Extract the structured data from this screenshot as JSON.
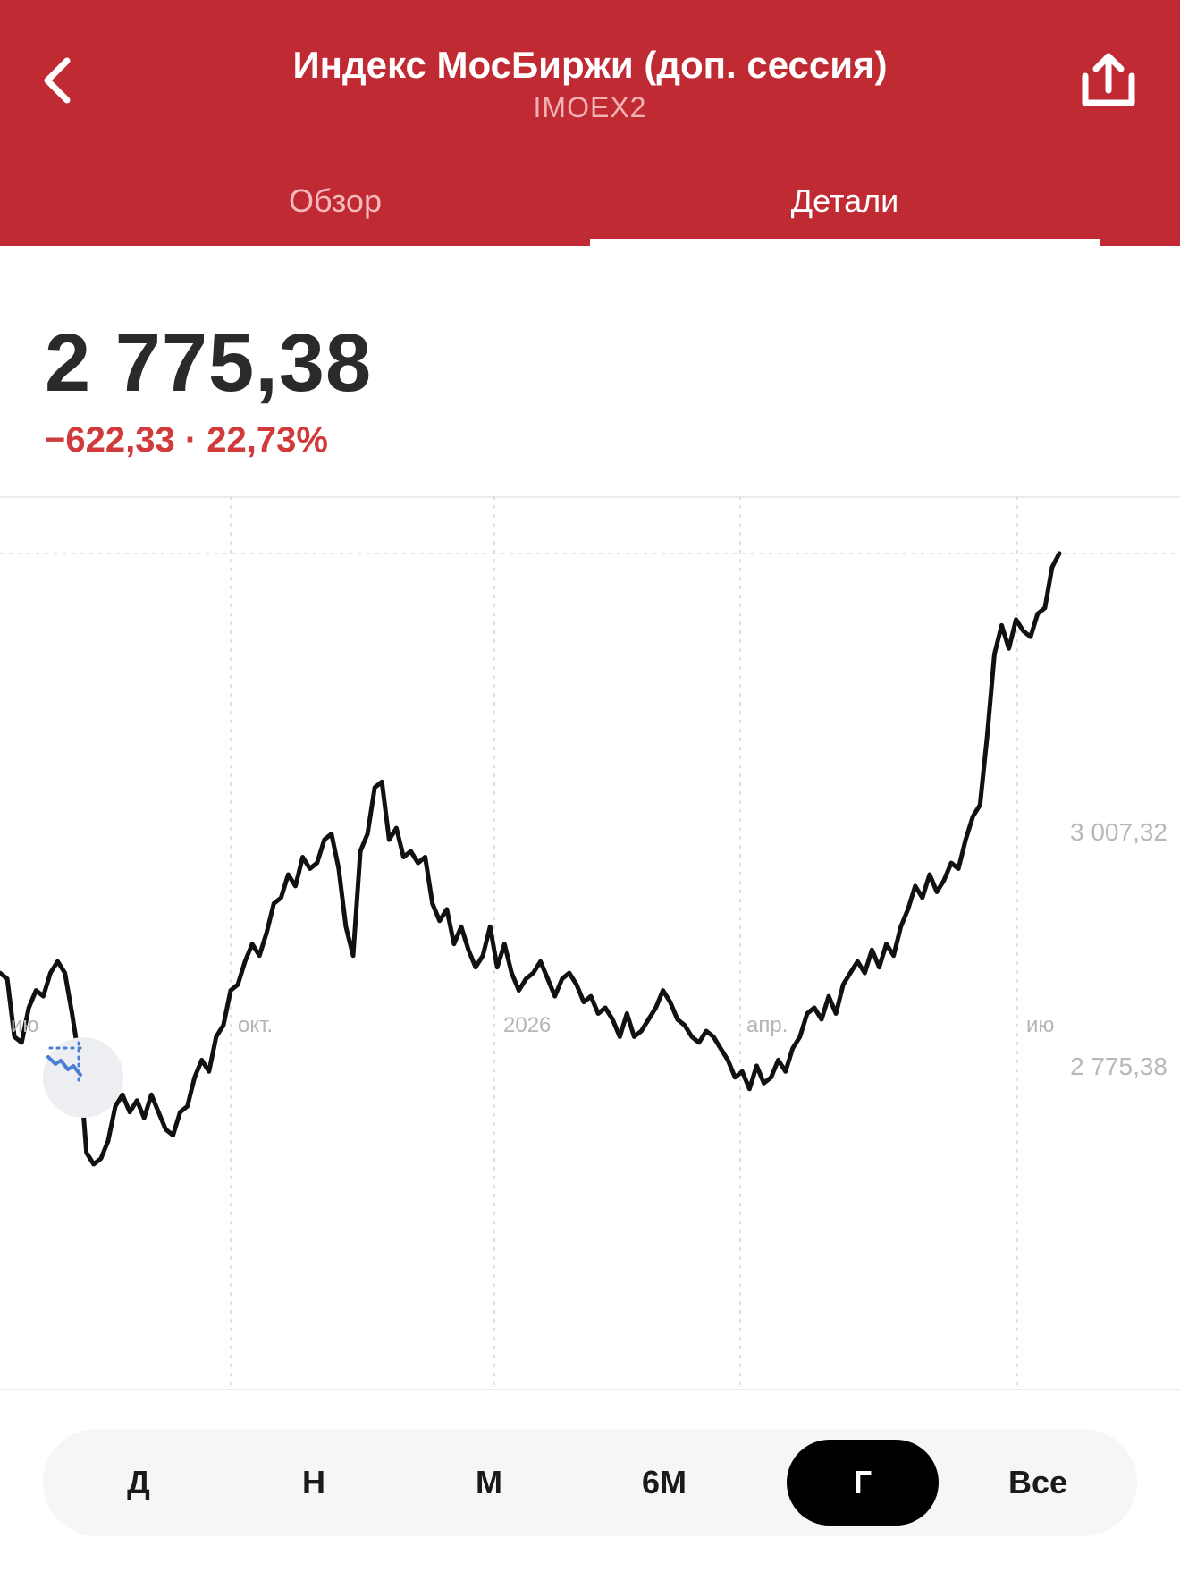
{
  "header": {
    "title": "Индекс МосБиржи (доп. сессия)",
    "ticker": "IMOEX2",
    "back_icon": "back-arrow-icon",
    "share_icon": "share-icon",
    "background_color": "#c02a33"
  },
  "tabs": [
    {
      "label": "Обзор",
      "active": false
    },
    {
      "label": "Детали",
      "active": true
    }
  ],
  "price": {
    "value": "2 775,38",
    "change": "−622,33 · 22,73%",
    "change_color": "#d03a3a"
  },
  "chart_range": {
    "high_label": "2 775,38",
    "low_label": "3 007,32"
  },
  "chart_type_icon": "chart-line-icon",
  "periods": [
    {
      "label": "Д",
      "active": false
    },
    {
      "label": "Н",
      "active": false
    },
    {
      "label": "М",
      "active": false
    },
    {
      "label": "6М",
      "active": false
    },
    {
      "label": "Г",
      "active": true
    },
    {
      "label": "Все",
      "active": false
    }
  ],
  "chart_data": {
    "type": "line",
    "title": "",
    "xlabel": "",
    "ylabel": "",
    "x_tick_labels": [
      "ию",
      "окт.",
      "2026",
      "апр.",
      "ию"
    ],
    "grid": true,
    "series": [
      {
        "values": [
          2935,
          2930,
          2880,
          2875,
          2905,
          2920,
          2915,
          2935,
          2945,
          2935,
          2900,
          2860,
          2780,
          2770,
          2775,
          2790,
          2820,
          2830,
          2815,
          2825,
          2810,
          2830,
          2815,
          2800,
          2795,
          2815,
          2820,
          2845,
          2860,
          2850,
          2880,
          2890,
          2920,
          2925,
          2945,
          2960,
          2950,
          2970,
          2995,
          3000,
          3020,
          3010,
          3035,
          3025,
          3030,
          3050,
          3055,
          3025,
          2975,
          2950,
          3040,
          3055,
          3095,
          3100,
          3050,
          3060,
          3035,
          3040,
          3030,
          3035,
          2995,
          2980,
          2990,
          2960,
          2975,
          2955,
          2940,
          2950,
          2975,
          2940,
          2960,
          2935,
          2920,
          2930,
          2935,
          2945,
          2930,
          2915,
          2930,
          2935,
          2925,
          2910,
          2915,
          2900,
          2905,
          2895,
          2880,
          2900,
          2880,
          2885,
          2895,
          2905,
          2920,
          2910,
          2895,
          2890,
          2880,
          2875,
          2885,
          2880,
          2870,
          2860,
          2845,
          2850,
          2835,
          2855,
          2840,
          2845,
          2860,
          2850,
          2870,
          2880,
          2900,
          2905,
          2895,
          2915,
          2900,
          2925,
          2935,
          2945,
          2935,
          2955,
          2940,
          2960,
          2950,
          2975,
          2990,
          3010,
          3000,
          3020,
          3005,
          3015,
          3030,
          3025,
          3050,
          3070,
          3080,
          3140,
          3210,
          3235,
          3215,
          3240,
          3230,
          3225,
          3245,
          3250,
          3285,
          3297
        ],
        "color": "#111111"
      }
    ]
  }
}
